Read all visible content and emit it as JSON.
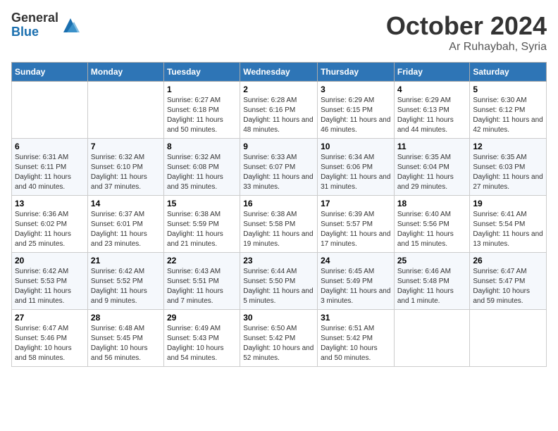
{
  "logo": {
    "general": "General",
    "blue": "Blue"
  },
  "title": {
    "month": "October 2024",
    "location": "Ar Ruhaybah, Syria"
  },
  "weekdays": [
    "Sunday",
    "Monday",
    "Tuesday",
    "Wednesday",
    "Thursday",
    "Friday",
    "Saturday"
  ],
  "weeks": [
    [
      {
        "day": "",
        "sunrise": "",
        "sunset": "",
        "daylight": ""
      },
      {
        "day": "",
        "sunrise": "",
        "sunset": "",
        "daylight": ""
      },
      {
        "day": "1",
        "sunrise": "Sunrise: 6:27 AM",
        "sunset": "Sunset: 6:18 PM",
        "daylight": "Daylight: 11 hours and 50 minutes."
      },
      {
        "day": "2",
        "sunrise": "Sunrise: 6:28 AM",
        "sunset": "Sunset: 6:16 PM",
        "daylight": "Daylight: 11 hours and 48 minutes."
      },
      {
        "day": "3",
        "sunrise": "Sunrise: 6:29 AM",
        "sunset": "Sunset: 6:15 PM",
        "daylight": "Daylight: 11 hours and 46 minutes."
      },
      {
        "day": "4",
        "sunrise": "Sunrise: 6:29 AM",
        "sunset": "Sunset: 6:13 PM",
        "daylight": "Daylight: 11 hours and 44 minutes."
      },
      {
        "day": "5",
        "sunrise": "Sunrise: 6:30 AM",
        "sunset": "Sunset: 6:12 PM",
        "daylight": "Daylight: 11 hours and 42 minutes."
      }
    ],
    [
      {
        "day": "6",
        "sunrise": "Sunrise: 6:31 AM",
        "sunset": "Sunset: 6:11 PM",
        "daylight": "Daylight: 11 hours and 40 minutes."
      },
      {
        "day": "7",
        "sunrise": "Sunrise: 6:32 AM",
        "sunset": "Sunset: 6:10 PM",
        "daylight": "Daylight: 11 hours and 37 minutes."
      },
      {
        "day": "8",
        "sunrise": "Sunrise: 6:32 AM",
        "sunset": "Sunset: 6:08 PM",
        "daylight": "Daylight: 11 hours and 35 minutes."
      },
      {
        "day": "9",
        "sunrise": "Sunrise: 6:33 AM",
        "sunset": "Sunset: 6:07 PM",
        "daylight": "Daylight: 11 hours and 33 minutes."
      },
      {
        "day": "10",
        "sunrise": "Sunrise: 6:34 AM",
        "sunset": "Sunset: 6:06 PM",
        "daylight": "Daylight: 11 hours and 31 minutes."
      },
      {
        "day": "11",
        "sunrise": "Sunrise: 6:35 AM",
        "sunset": "Sunset: 6:04 PM",
        "daylight": "Daylight: 11 hours and 29 minutes."
      },
      {
        "day": "12",
        "sunrise": "Sunrise: 6:35 AM",
        "sunset": "Sunset: 6:03 PM",
        "daylight": "Daylight: 11 hours and 27 minutes."
      }
    ],
    [
      {
        "day": "13",
        "sunrise": "Sunrise: 6:36 AM",
        "sunset": "Sunset: 6:02 PM",
        "daylight": "Daylight: 11 hours and 25 minutes."
      },
      {
        "day": "14",
        "sunrise": "Sunrise: 6:37 AM",
        "sunset": "Sunset: 6:01 PM",
        "daylight": "Daylight: 11 hours and 23 minutes."
      },
      {
        "day": "15",
        "sunrise": "Sunrise: 6:38 AM",
        "sunset": "Sunset: 5:59 PM",
        "daylight": "Daylight: 11 hours and 21 minutes."
      },
      {
        "day": "16",
        "sunrise": "Sunrise: 6:38 AM",
        "sunset": "Sunset: 5:58 PM",
        "daylight": "Daylight: 11 hours and 19 minutes."
      },
      {
        "day": "17",
        "sunrise": "Sunrise: 6:39 AM",
        "sunset": "Sunset: 5:57 PM",
        "daylight": "Daylight: 11 hours and 17 minutes."
      },
      {
        "day": "18",
        "sunrise": "Sunrise: 6:40 AM",
        "sunset": "Sunset: 5:56 PM",
        "daylight": "Daylight: 11 hours and 15 minutes."
      },
      {
        "day": "19",
        "sunrise": "Sunrise: 6:41 AM",
        "sunset": "Sunset: 5:54 PM",
        "daylight": "Daylight: 11 hours and 13 minutes."
      }
    ],
    [
      {
        "day": "20",
        "sunrise": "Sunrise: 6:42 AM",
        "sunset": "Sunset: 5:53 PM",
        "daylight": "Daylight: 11 hours and 11 minutes."
      },
      {
        "day": "21",
        "sunrise": "Sunrise: 6:42 AM",
        "sunset": "Sunset: 5:52 PM",
        "daylight": "Daylight: 11 hours and 9 minutes."
      },
      {
        "day": "22",
        "sunrise": "Sunrise: 6:43 AM",
        "sunset": "Sunset: 5:51 PM",
        "daylight": "Daylight: 11 hours and 7 minutes."
      },
      {
        "day": "23",
        "sunrise": "Sunrise: 6:44 AM",
        "sunset": "Sunset: 5:50 PM",
        "daylight": "Daylight: 11 hours and 5 minutes."
      },
      {
        "day": "24",
        "sunrise": "Sunrise: 6:45 AM",
        "sunset": "Sunset: 5:49 PM",
        "daylight": "Daylight: 11 hours and 3 minutes."
      },
      {
        "day": "25",
        "sunrise": "Sunrise: 6:46 AM",
        "sunset": "Sunset: 5:48 PM",
        "daylight": "Daylight: 11 hours and 1 minute."
      },
      {
        "day": "26",
        "sunrise": "Sunrise: 6:47 AM",
        "sunset": "Sunset: 5:47 PM",
        "daylight": "Daylight: 10 hours and 59 minutes."
      }
    ],
    [
      {
        "day": "27",
        "sunrise": "Sunrise: 6:47 AM",
        "sunset": "Sunset: 5:46 PM",
        "daylight": "Daylight: 10 hours and 58 minutes."
      },
      {
        "day": "28",
        "sunrise": "Sunrise: 6:48 AM",
        "sunset": "Sunset: 5:45 PM",
        "daylight": "Daylight: 10 hours and 56 minutes."
      },
      {
        "day": "29",
        "sunrise": "Sunrise: 6:49 AM",
        "sunset": "Sunset: 5:43 PM",
        "daylight": "Daylight: 10 hours and 54 minutes."
      },
      {
        "day": "30",
        "sunrise": "Sunrise: 6:50 AM",
        "sunset": "Sunset: 5:42 PM",
        "daylight": "Daylight: 10 hours and 52 minutes."
      },
      {
        "day": "31",
        "sunrise": "Sunrise: 6:51 AM",
        "sunset": "Sunset: 5:42 PM",
        "daylight": "Daylight: 10 hours and 50 minutes."
      },
      {
        "day": "",
        "sunrise": "",
        "sunset": "",
        "daylight": ""
      },
      {
        "day": "",
        "sunrise": "",
        "sunset": "",
        "daylight": ""
      }
    ]
  ]
}
